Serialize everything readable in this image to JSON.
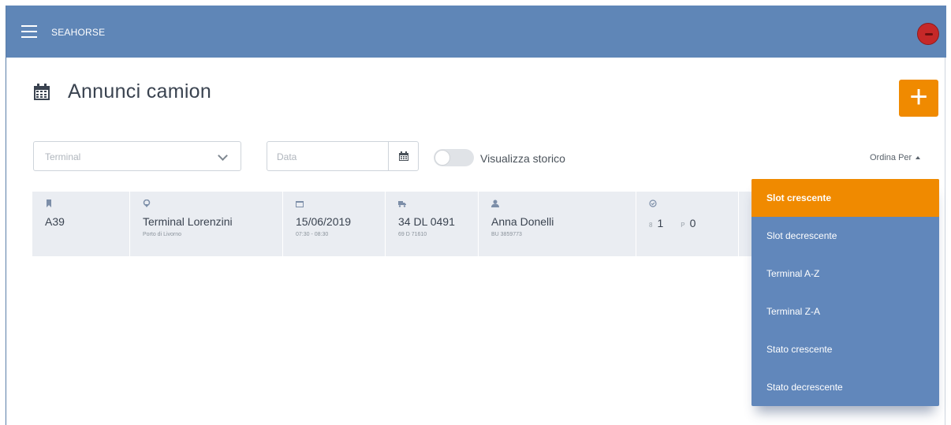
{
  "app": {
    "brand": "SEAHORSE"
  },
  "page": {
    "title": "Annunci camion",
    "add_label": "+"
  },
  "filters": {
    "terminal_placeholder": "Terminal",
    "date_placeholder": "Data",
    "toggle_label": "Visualizza storico",
    "toggle_on": false,
    "sort_label": "Ordina Per"
  },
  "row": {
    "code": "A39",
    "terminal_name": "Terminal Lorenzini",
    "terminal_location": "Porto di Livorno",
    "date": "15/06/2019",
    "time_slot": "07:30 - 08:30",
    "plate": "34 DL 0491",
    "plate_sub": "69 D 71610",
    "driver_name": "Anna Donelli",
    "driver_sub": "BU 3859773",
    "count_a_prefix": "8",
    "count_a": "1",
    "count_b_prefix": "P",
    "count_b": "0"
  },
  "sort_menu": {
    "items": [
      "Slot crescente",
      "Slot decrescente",
      "Terminal A-Z",
      "Terminal Z-A",
      "Stato crescente",
      "Stato decrescente"
    ],
    "active_index": 0
  },
  "colors": {
    "topbar": "#5f86b7",
    "accent": "#f08a00",
    "menu": "#6187bb",
    "row": "#eaedf2"
  }
}
